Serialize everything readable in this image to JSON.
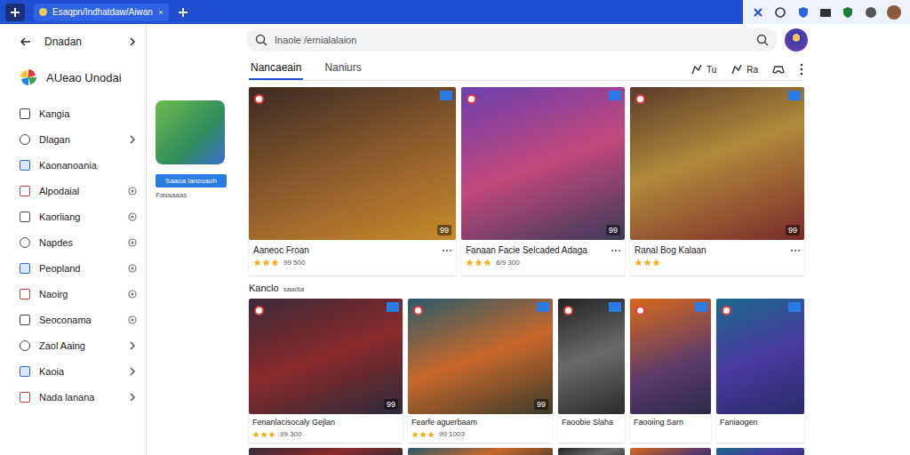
{
  "window": {
    "title": "Esaqpn/Indhatdaw/Aiwan"
  },
  "sidebar": {
    "title": "Dnadan",
    "app_name": "AUeao Unodai",
    "items": [
      {
        "label": "Kangia",
        "kind": "plain"
      },
      {
        "label": "Dlagan",
        "kind": "chevron"
      },
      {
        "label": "Kaonanoania",
        "kind": "plain"
      },
      {
        "label": "Alpodaial",
        "kind": "dot"
      },
      {
        "label": "Kaoriiang",
        "kind": "dot"
      },
      {
        "label": "Napdes",
        "kind": "dot"
      },
      {
        "label": "Peopland",
        "kind": "dot"
      },
      {
        "label": "Naoirg",
        "kind": "dot"
      },
      {
        "label": "Seoconama",
        "kind": "dot"
      },
      {
        "label": "Zaol Aaing",
        "kind": "chevron"
      },
      {
        "label": "Kaoia",
        "kind": "chevron"
      },
      {
        "label": "Nada lanana",
        "kind": "chevron"
      }
    ]
  },
  "featured": {
    "button": "Saaoa lancoaoh",
    "caption": "Fasaaaas"
  },
  "search": {
    "placeholder": "Inaole /ernialalaion"
  },
  "tabs": [
    {
      "label": "Nancaeain",
      "selected": true
    },
    {
      "label": "Naniurs",
      "selected": false
    }
  ],
  "actions": [
    {
      "label": "Tu"
    },
    {
      "label": "Ra"
    }
  ],
  "top_games": [
    {
      "title": "Aaneoc Froan",
      "stars": 3,
      "rating": "99 500",
      "badge": "99"
    },
    {
      "title": "Fanaan Facie Selcaded Adaga",
      "stars": 3,
      "rating": "8/9 300",
      "badge": "99"
    },
    {
      "title": "Ranal Bog Kalaan",
      "stars": 3,
      "rating": "",
      "badge": "99"
    }
  ],
  "section": {
    "title": "Kanclo",
    "subtitle": "saadia"
  },
  "games": [
    {
      "title": "Fenanlacisocaly Gejlan",
      "stars": 3,
      "rating": "99 300",
      "badge": "99"
    },
    {
      "title": "Fearfe aguerbaam",
      "stars": 3,
      "rating": "99 1003",
      "badge": "99"
    },
    {
      "title": "Faoobie Slaha",
      "stars": 0,
      "rating": ""
    },
    {
      "title": "Faooiing Sarn",
      "stars": 0,
      "rating": ""
    },
    {
      "title": "Faniaogen",
      "stars": 0,
      "rating": ""
    }
  ]
}
